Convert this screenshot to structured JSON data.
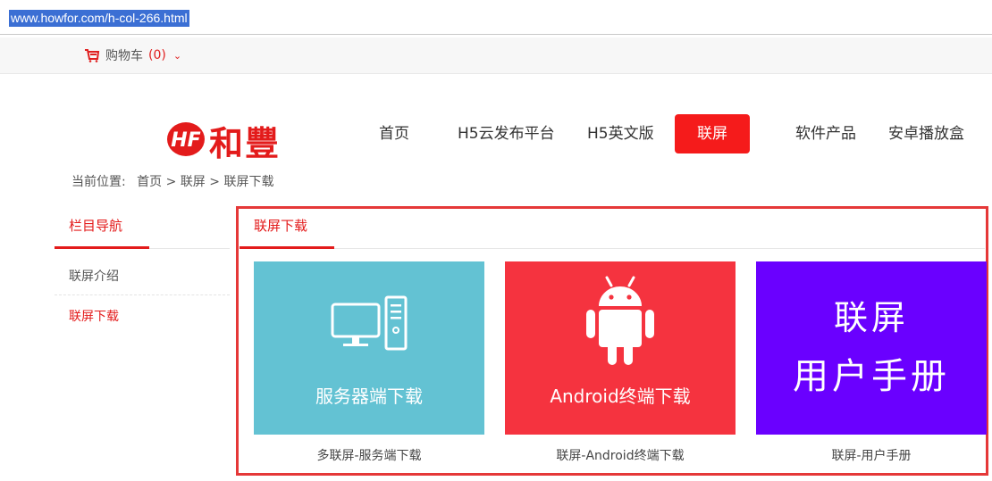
{
  "browser": {
    "url": "www.howfor.com/h-col-266.html"
  },
  "topbar": {
    "cart_label": "购物车",
    "cart_count": "(0)",
    "chevron": "⌄"
  },
  "logo": {
    "text": "和豐",
    "mark": "HF"
  },
  "nav": {
    "items": [
      {
        "label": "首页"
      },
      {
        "label": "H5云发布平台"
      },
      {
        "label": "H5英文版"
      },
      {
        "label": "联屏",
        "active": true
      },
      {
        "label": "软件产品"
      },
      {
        "label": "安卓播放盒"
      }
    ]
  },
  "breadcrumb": {
    "prefix": "当前位置:",
    "home": "首页",
    "sep1": ">",
    "section": "联屏",
    "sep2": ">",
    "current": "联屏下载"
  },
  "sidebar": {
    "title": "栏目导航",
    "items": [
      {
        "label": "联屏介绍",
        "active": false
      },
      {
        "label": "联屏下载",
        "active": true
      }
    ]
  },
  "content": {
    "title": "联屏下载",
    "tiles": [
      {
        "icon": "computer-icon",
        "label": "服务器端下载",
        "caption": "多联屏-服务端下载",
        "color": "#63c2d3"
      },
      {
        "icon": "android-icon",
        "label": "Android终端下载",
        "caption": "联屏-Android终端下载",
        "color": "#f5333f"
      },
      {
        "icon": "",
        "label_line1": "联屏",
        "label_line2": "用户手册",
        "caption": "联屏-用户手册",
        "color": "#6a00ff"
      }
    ]
  },
  "colors": {
    "accent": "#e31b1b",
    "nav_active": "#f51b1b",
    "box_border": "#e53838"
  }
}
